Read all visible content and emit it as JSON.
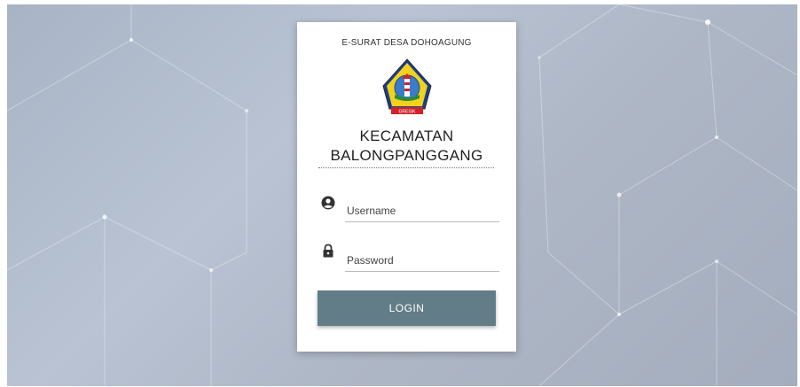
{
  "login": {
    "app_title": "E-SURAT DESA DOHOAGUNG",
    "org_line1": "KECAMATAN",
    "org_line2": "BALONGPANGGANG",
    "logo_banner": "GRESIK",
    "username_placeholder": "Username",
    "password_placeholder": "Password",
    "login_label": "LOGIN"
  },
  "icons": {
    "username": "user-circle-icon",
    "password": "lock-icon"
  },
  "colors": {
    "button": "#627d87",
    "card": "#ffffff",
    "background": "#b4bfcf"
  }
}
